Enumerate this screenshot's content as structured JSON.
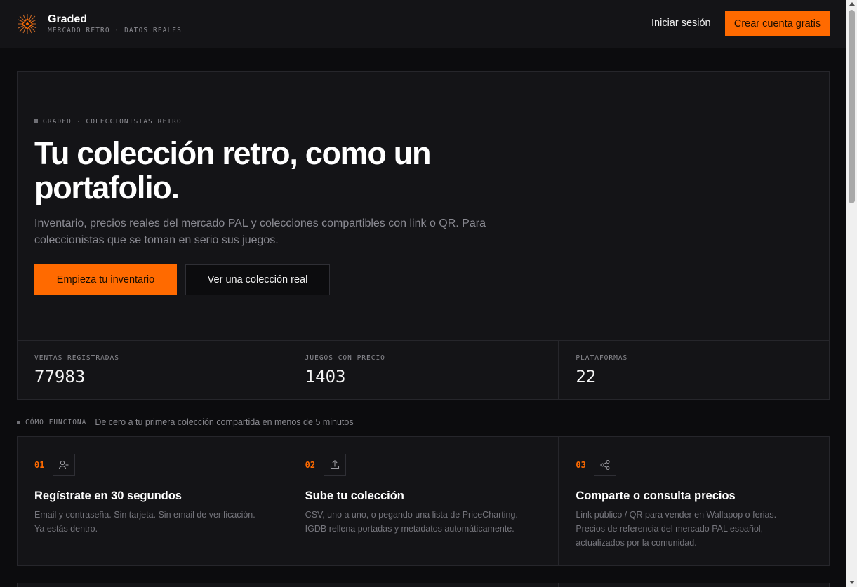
{
  "brand": {
    "name": "Graded",
    "tagline": "MERCADO RETRO · DATOS REALES"
  },
  "nav": {
    "login": "Iniciar sesión",
    "signup": "Crear cuenta gratis"
  },
  "hero": {
    "eyebrow": "GRADED · COLECCIONISTAS RETRO",
    "title_line1": "Tu colección retro, como un",
    "title_line2": "portafolio.",
    "description": "Inventario, precios reales del mercado PAL y colecciones compartibles con link o QR. Para coleccionistas que se toman en serio sus juegos.",
    "primary_cta": "Empieza tu inventario",
    "secondary_cta": "Ver una colección real"
  },
  "stats": [
    {
      "label": "VENTAS REGISTRADAS",
      "value": "77983"
    },
    {
      "label": "JUEGOS CON PRECIO",
      "value": "1403"
    },
    {
      "label": "PLATAFORMAS",
      "value": "22"
    }
  ],
  "how": {
    "label": "CÓMO FUNCIONA",
    "subtitle": "De cero a tu primera colección compartida en menos de 5 minutos",
    "steps": [
      {
        "num": "01",
        "icon": "user-plus-icon",
        "title": "Regístrate en 30 segundos",
        "desc": "Email y contraseña. Sin tarjeta. Sin email de verificación. Ya estás dentro."
      },
      {
        "num": "02",
        "icon": "upload-icon",
        "title": "Sube tu colección",
        "desc": "CSV, uno a uno, o pegando una lista de PriceCharting. IGDB rellena portadas y metadatos automáticamente."
      },
      {
        "num": "03",
        "icon": "share-icon",
        "title": "Comparte o consulta precios",
        "desc": "Link público / QR para vender en Wallapop o ferias. Precios de referencia del mercado PAL español, actualizados por la comunidad."
      }
    ]
  },
  "colors": {
    "accent": "#ff6a00",
    "background": "#0c0c0e",
    "panel": "#141417",
    "border": "#26262b"
  }
}
